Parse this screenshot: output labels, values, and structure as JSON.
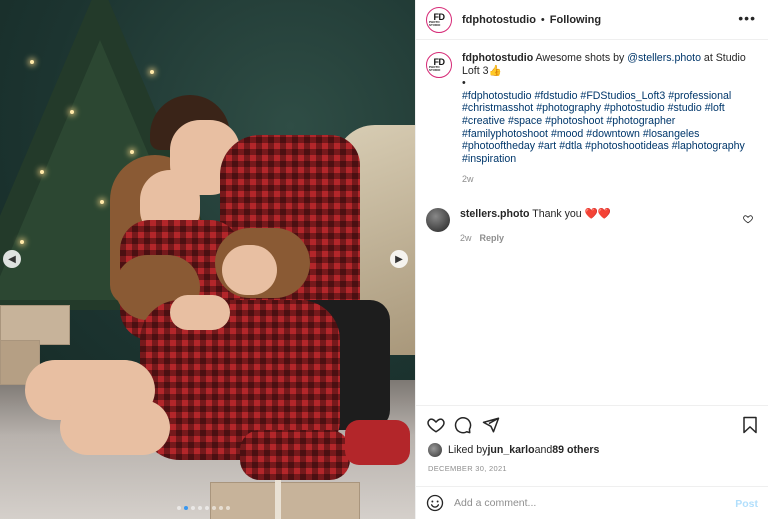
{
  "post": {
    "username": "fdphotostudio",
    "separator": "•",
    "follow_label": "Following",
    "more_label": "•••",
    "avatar_text_top": "FD",
    "avatar_text_bottom": "PHOTO STUDIO"
  },
  "caption": {
    "username": "fdphotostudio",
    "text_before_mention": " Awesome shots by ",
    "mention": "@stellers.photo",
    "text_after_mention": " at Studio Loft 3",
    "emoji": "👍",
    "bullet": "•",
    "hashtags": [
      "#fdphotostudio",
      "#fdstudio",
      "#FDStudios_Loft3",
      "#professional",
      "#christmasshot",
      "#photography",
      "#photostudio",
      "#studio",
      "#loft",
      "#creative",
      "#space",
      "#photoshoot",
      "#photographer",
      "#familyphotoshoot",
      "#mood",
      "#downtown",
      "#losangeles",
      "#photooftheday",
      "#art",
      "#dtla",
      "#photoshootideas",
      "#laphotography",
      "#inspiration"
    ],
    "time": "2w"
  },
  "comment": {
    "username": "stellers.photo",
    "text": " Thank you ",
    "hearts": "❤️❤️",
    "time": "2w",
    "reply_label": "Reply"
  },
  "likes": {
    "prefix": "Liked by ",
    "user": "jun_karlo",
    "and": " and ",
    "others": "89 others"
  },
  "date": "DECEMBER 30, 2021",
  "add_comment": {
    "placeholder": "Add a comment...",
    "post_label": "Post"
  },
  "carousel": {
    "dots": 8,
    "active_index": 1,
    "prev_icon": "chevron-left-icon",
    "next_icon": "chevron-right-icon"
  },
  "colors": {
    "link": "#00376b",
    "post_disabled": "#b2dffc",
    "heart": "#e0245e",
    "active_dot": "#3897f0"
  }
}
